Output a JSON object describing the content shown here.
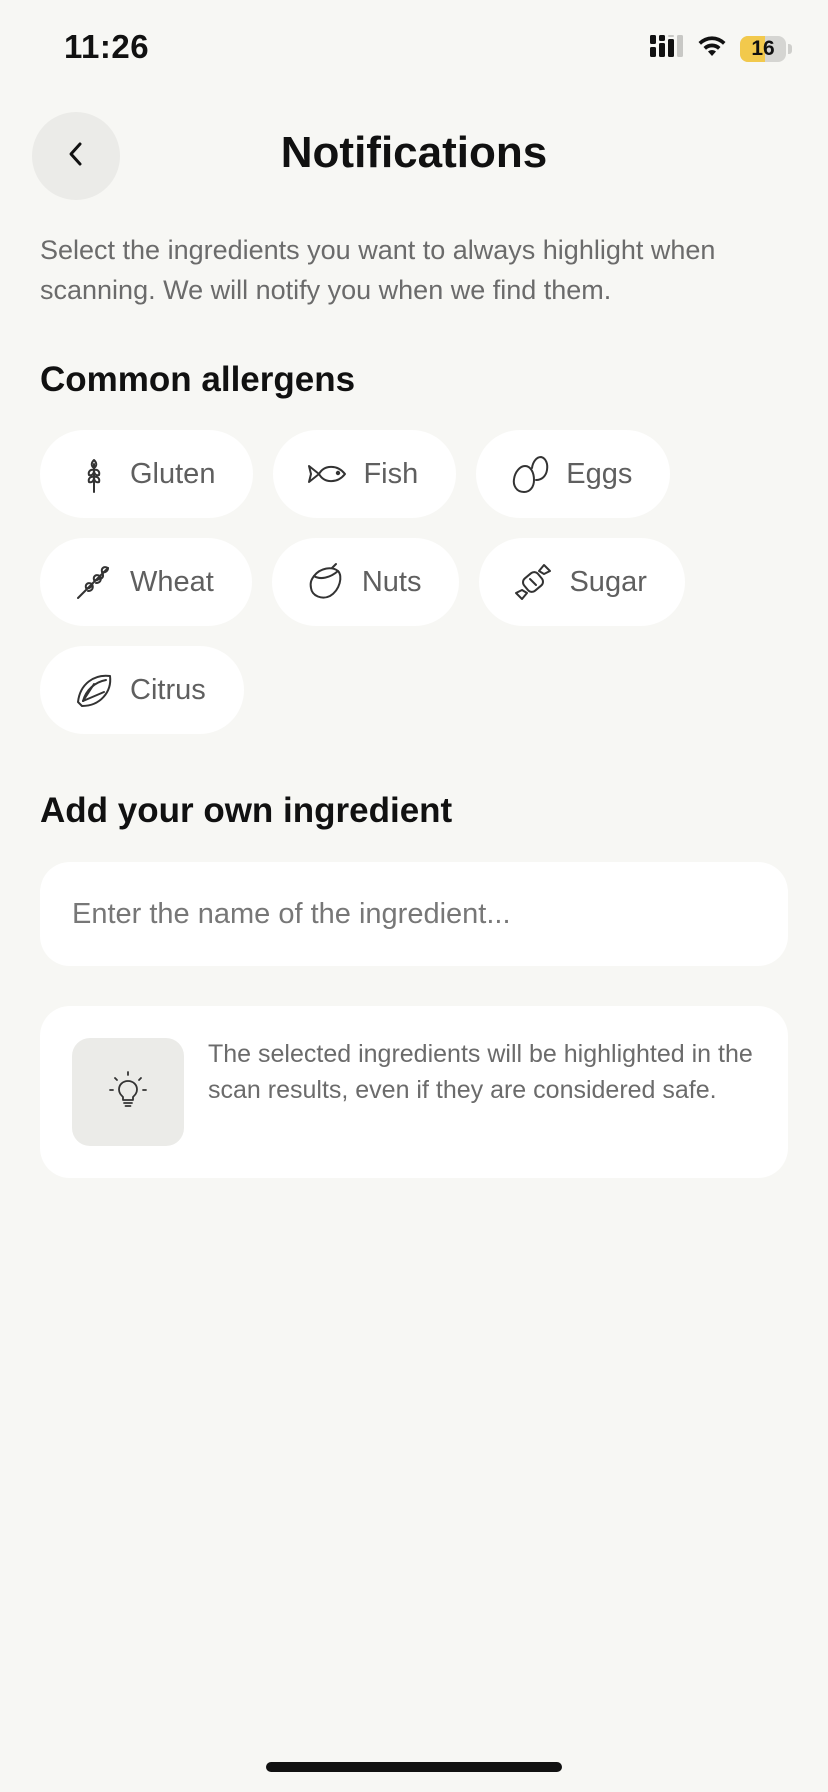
{
  "status_bar": {
    "time": "11:26",
    "battery_level": "16",
    "battery_fraction": 0.55,
    "icons": [
      "cellular-signal-icon",
      "wifi-icon",
      "battery-icon"
    ]
  },
  "header": {
    "title": "Notifications",
    "back_icon": "chevron-left-icon"
  },
  "description": "Select the ingredients you want to always highlight when scanning. We will notify you when we find them.",
  "allergens": {
    "title": "Common allergens",
    "items": [
      {
        "label": "Gluten",
        "icon": "wheat-stalk-icon"
      },
      {
        "label": "Fish",
        "icon": "fish-icon"
      },
      {
        "label": "Eggs",
        "icon": "eggs-icon"
      },
      {
        "label": "Wheat",
        "icon": "wheat-icon"
      },
      {
        "label": "Nuts",
        "icon": "nut-icon"
      },
      {
        "label": "Sugar",
        "icon": "candy-icon"
      },
      {
        "label": "Citrus",
        "icon": "citrus-icon"
      }
    ]
  },
  "custom_ingredient": {
    "title": "Add your own ingredient",
    "placeholder": "Enter the name of the ingredient...",
    "value": ""
  },
  "info": {
    "icon": "lightbulb-icon",
    "text": "The selected ingredients will be highlighted in the scan results, even if they are considered safe."
  },
  "colors": {
    "background": "#f7f7f4",
    "card": "#ffffff",
    "muted_fill": "#ebebe8",
    "text_primary": "#111111",
    "text_secondary": "#6b6b6b",
    "battery_accent": "#f2c94c"
  }
}
